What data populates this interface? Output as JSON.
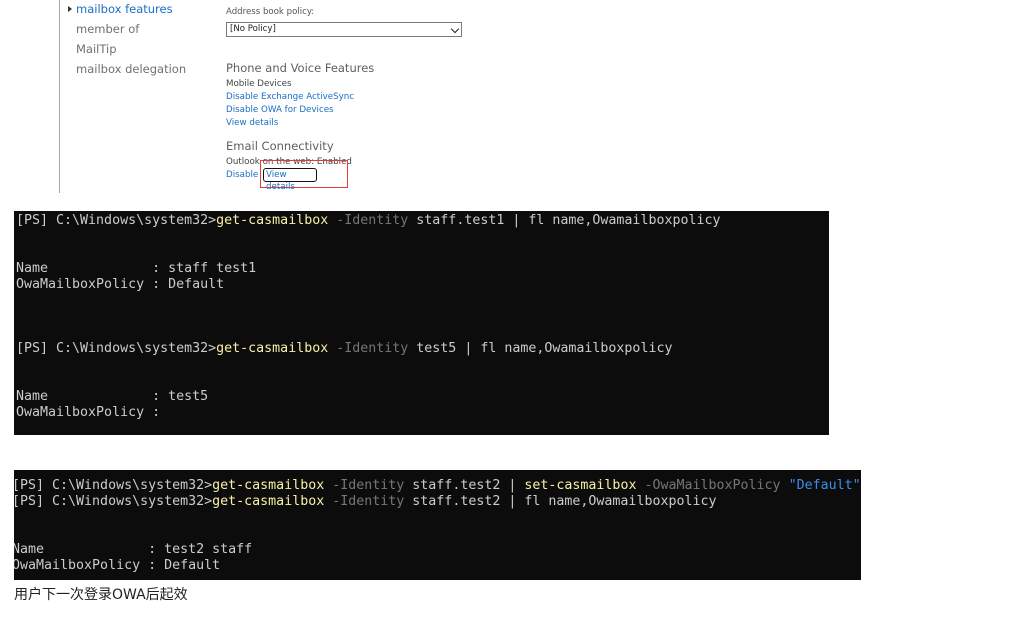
{
  "nav": {
    "items": [
      {
        "label": "mailbox features",
        "active": true
      },
      {
        "label": "member of",
        "active": false
      },
      {
        "label": "MailTip",
        "active": false
      },
      {
        "label": "mailbox delegation",
        "active": false
      }
    ]
  },
  "address_book": {
    "label": "Address book policy:",
    "selected": "[No Policy]"
  },
  "phone_voice": {
    "title": "Phone and Voice Features",
    "mobile_devices": "Mobile Devices",
    "disable_activesync": "Disable Exchange ActiveSync",
    "disable_owa_devices": "Disable OWA for Devices",
    "view_details": "View details"
  },
  "email_connectivity": {
    "title": "Email Connectivity",
    "status": "Outlook on the web: Enabled",
    "disable": "Disable",
    "view_details": "View details"
  },
  "console1": {
    "l1_prompt": "[PS] C:\\Windows\\system32>",
    "l1_cmd": "get-casmailbox",
    "l1_param": " -Identity",
    "l1_rest": " staff.test1 | fl name,Owamailboxpolicy",
    "l2": "Name             : staff test1",
    "l3": "OwaMailboxPolicy : Default",
    "l4_prompt": "[PS] C:\\Windows\\system32>",
    "l4_cmd": "get-casmailbox",
    "l4_param": " -Identity",
    "l4_rest": " test5 | fl name,Owamailboxpolicy",
    "l5": "Name             : test5",
    "l6": "OwaMailboxPolicy :"
  },
  "console2": {
    "l1_prompt": "[PS] C:\\Windows\\system32>",
    "l1_cmd": "get-casmailbox",
    "l1_param": " -Identity",
    "l1_rest": " staff.test2 | ",
    "l1_cmd2": "set-casmailbox",
    "l1_param2": " -OwaMailboxPolicy",
    "l1_str": " \"Default\"",
    "l2_prompt": "[PS] C:\\Windows\\system32>",
    "l2_cmd": "get-casmailbox",
    "l2_param": " -Identity",
    "l2_rest": " staff.test2 | fl name,Owamailboxpolicy",
    "l3": "Name             : test2 staff",
    "l4": "OwaMailboxPolicy : Default"
  },
  "caption": "用户下一次登录OWA后起效",
  "colors": {
    "link": "#1a6fc4",
    "highlight": "#e23b3b",
    "console_bg": "#0c0c0c",
    "cmdlet": "#f9f1a5",
    "parameter": "#767676",
    "string": "#3b8eea"
  }
}
